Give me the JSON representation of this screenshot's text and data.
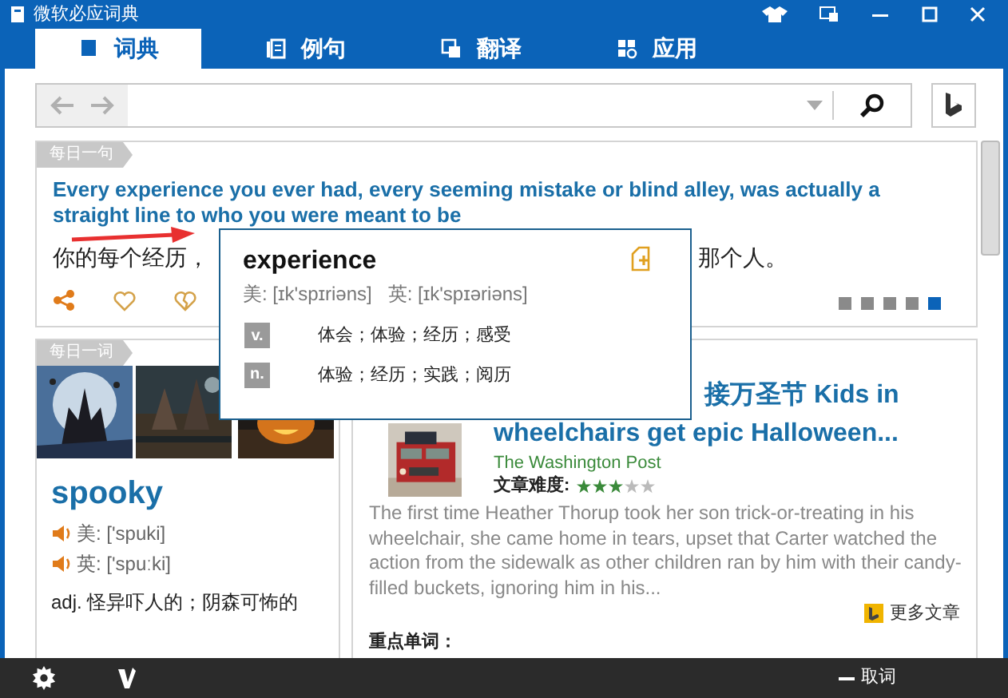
{
  "window": {
    "title": "微软必应词典"
  },
  "tabs": [
    {
      "label": "词典",
      "selected": true
    },
    {
      "label": "例句",
      "selected": false
    },
    {
      "label": "翻译",
      "selected": false
    },
    {
      "label": "应用",
      "selected": false
    }
  ],
  "daily_sentence": {
    "badge": "每日一句",
    "english": "Every experience you ever had, every seeming mistake or blind alley, was actually a straight line to who you were meant to be",
    "chinese_start": "你的每个经历，",
    "chinese_end": "那个人。",
    "pager": [
      {
        "selected": false
      },
      {
        "selected": false
      },
      {
        "selected": false
      },
      {
        "selected": false
      },
      {
        "selected": true
      }
    ]
  },
  "popup": {
    "word": "experience",
    "us_pron": "美: [ɪk'spɪriəns]",
    "uk_pron": "英: [ɪk'spɪəriəns]",
    "senses": [
      {
        "pos": "v.",
        "meaning": "体会；体验；经历；感受"
      },
      {
        "pos": "n.",
        "meaning": "体验；经历；实践；阅历"
      }
    ]
  },
  "daily_word": {
    "badge": "每日一词",
    "word": "spooky",
    "us_pron": "美: ['spuki]",
    "uk_pron": "英: ['spuːki]",
    "definition": "adj. 怪异吓人的；阴森可怖的"
  },
  "article": {
    "title_line1": "接万圣节  Kids in",
    "title_line2": "wheelchairs get epic Halloween...",
    "source": "The Washington Post",
    "difficulty_label": "文章难度:",
    "stars": 3,
    "body": "The first time Heather Thorup took her son trick-or-treating in his wheelchair, she came home in tears, upset that Carter watched the action from the sidewalk as other children ran by him with their candy-filled buckets, ignoring him in his...",
    "more_link": "更多文章",
    "key_words_label": "重点单词："
  },
  "status_bar": {
    "capture_label": "取词"
  }
}
